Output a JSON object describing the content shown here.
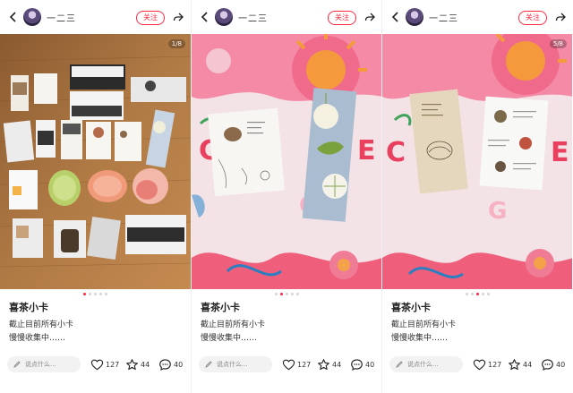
{
  "panels": [
    {
      "user": {
        "name": "一二三"
      },
      "follow_label": "关注",
      "counter": "1/8",
      "title": "喜茶小卡",
      "body_line1": "截止目前所有小卡",
      "body_line2": "慢慢收集中……",
      "comment_placeholder": "说点什么...",
      "likes": "127",
      "collects": "44",
      "comments": "40"
    },
    {
      "user": {
        "name": "一二三"
      },
      "follow_label": "关注",
      "counter": "",
      "title": "喜茶小卡",
      "body_line1": "截止目前所有小卡",
      "body_line2": "慢慢收集中……",
      "comment_placeholder": "说点什么...",
      "likes": "127",
      "collects": "44",
      "comments": "40"
    },
    {
      "user": {
        "name": "一二三"
      },
      "follow_label": "关注",
      "counter": "5/8",
      "title": "喜茶小卡",
      "body_line1": "截止目前所有小卡",
      "body_line2": "慢慢收集中……",
      "comment_placeholder": "说点什么...",
      "likes": "127",
      "collects": "44",
      "comments": "40"
    }
  ],
  "icons": {
    "back": "chevron-left-icon",
    "share": "share-arrow-icon",
    "edit": "pencil-icon",
    "like": "heart-icon",
    "collect": "star-icon",
    "comment": "speech-bubble-icon"
  },
  "colors": {
    "accent": "#ff2741",
    "wood": "#a9713e",
    "fabric_pink": "#f06a8c",
    "fabric_orange": "#f49a3c"
  }
}
